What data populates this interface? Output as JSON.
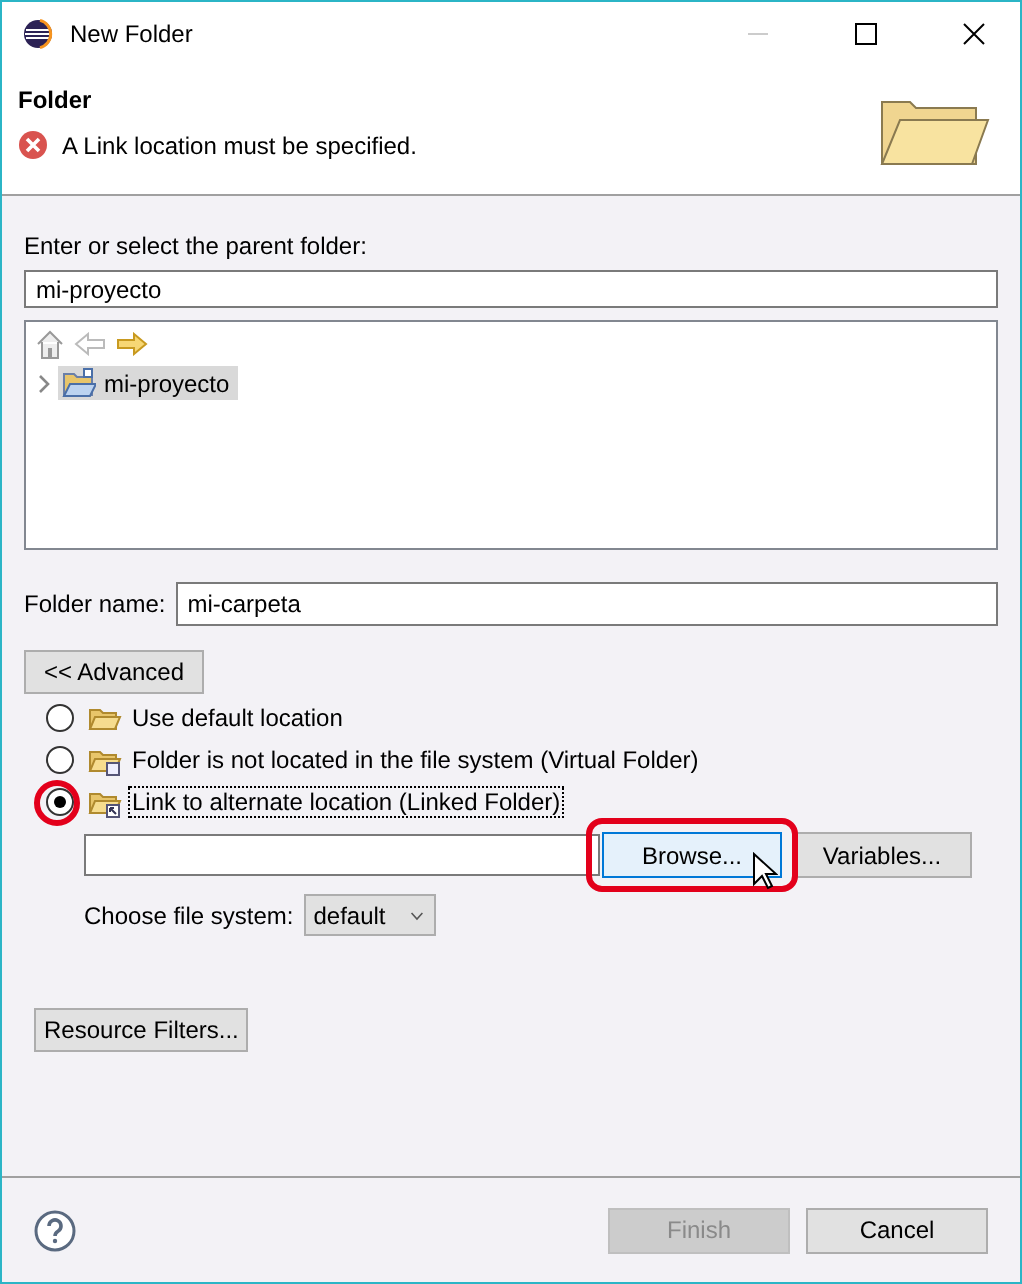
{
  "window": {
    "title": "New Folder"
  },
  "header": {
    "title": "Folder",
    "message": "A Link location must be specified.",
    "error": true
  },
  "parent_folder": {
    "label": "Enter or select the parent folder:",
    "value": "mi-proyecto"
  },
  "tree": {
    "items": [
      {
        "label": "mi-proyecto",
        "selected": true,
        "expanded": false
      }
    ]
  },
  "folder_name": {
    "label": "Folder name:",
    "value": "mi-carpeta"
  },
  "advanced_button": "<< Advanced",
  "location_options": [
    {
      "label": "Use default location",
      "kind": "default",
      "selected": false,
      "highlighted": false
    },
    {
      "label": "Folder is not located in the file system (Virtual Folder)",
      "kind": "virtual",
      "selected": false,
      "highlighted": false
    },
    {
      "label": "Link to alternate location (Linked Folder)",
      "kind": "linked",
      "selected": true,
      "highlighted": true
    }
  ],
  "browse_button": {
    "label": "Browse...",
    "highlighted": true
  },
  "variables_button": "Variables...",
  "file_system": {
    "label": "Choose file system:",
    "value": "default"
  },
  "resource_filters_button": "Resource Filters...",
  "buttons": [
    {
      "label": "Finish",
      "disabled": true
    },
    {
      "label": "Cancel",
      "disabled": false
    }
  ]
}
